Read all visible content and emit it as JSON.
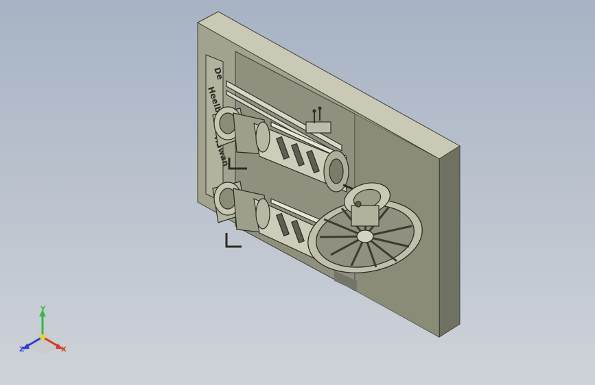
{
  "viewport": {
    "background_top": "#a7b3c4",
    "background_bottom": "#cfd3d9",
    "model_color": "#9c9c88",
    "shadow_color": "#55574a"
  },
  "model": {
    "plate_text": [
      "De",
      "Heelbey Hot",
      "Hawan"
    ]
  },
  "triad": {
    "x_label": "X",
    "y_label": "Y",
    "z_label": "Z",
    "x_color": "#d23a2a",
    "y_color": "#39b54a",
    "z_color": "#2d3fd1"
  }
}
